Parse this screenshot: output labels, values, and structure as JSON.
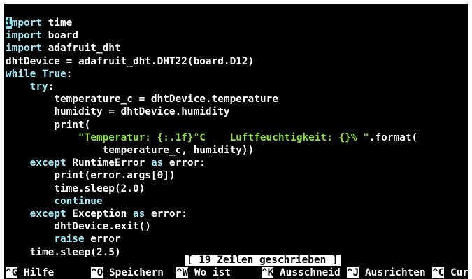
{
  "code_lines": [
    {
      "indent": "",
      "segments": [
        {
          "text": "i",
          "cls": "kw cursor"
        },
        {
          "text": "mport",
          "cls": "kw"
        },
        {
          "text": " time",
          "cls": ""
        }
      ]
    },
    {
      "indent": "",
      "segments": [
        {
          "text": "import",
          "cls": "kw"
        },
        {
          "text": " board",
          "cls": ""
        }
      ]
    },
    {
      "indent": "",
      "segments": [
        {
          "text": "import",
          "cls": "kw"
        },
        {
          "text": " adafruit_dht",
          "cls": ""
        }
      ]
    },
    {
      "indent": "",
      "segments": [
        {
          "text": "dhtDevice = adafruit_dht.DHT22(board.D12)",
          "cls": ""
        }
      ]
    },
    {
      "indent": "",
      "segments": [
        {
          "text": "while",
          "cls": "kw"
        },
        {
          "text": " ",
          "cls": ""
        },
        {
          "text": "True",
          "cls": "kw"
        },
        {
          "text": ":",
          "cls": ""
        }
      ]
    },
    {
      "indent": "    ",
      "segments": [
        {
          "text": "try",
          "cls": "kw"
        },
        {
          "text": ":",
          "cls": ""
        }
      ]
    },
    {
      "indent": "        ",
      "segments": [
        {
          "text": "temperature_c = dhtDevice.temperature",
          "cls": ""
        }
      ]
    },
    {
      "indent": "        ",
      "segments": [
        {
          "text": "humidity = dhtDevice.humidity",
          "cls": ""
        }
      ]
    },
    {
      "indent": "        ",
      "segments": [
        {
          "text": "print(",
          "cls": ""
        }
      ]
    },
    {
      "indent": "            ",
      "segments": [
        {
          "text": "\"Temperatur: {:.1f}°C    Luftfeuchtigkeit: {}% \"",
          "cls": "str"
        },
        {
          "text": ".format(",
          "cls": ""
        }
      ]
    },
    {
      "indent": "                ",
      "segments": [
        {
          "text": "temperature_c, humidity))",
          "cls": ""
        }
      ]
    },
    {
      "indent": "    ",
      "segments": [
        {
          "text": "except",
          "cls": "kw"
        },
        {
          "text": " RuntimeError ",
          "cls": ""
        },
        {
          "text": "as",
          "cls": "kw"
        },
        {
          "text": " error:",
          "cls": ""
        }
      ]
    },
    {
      "indent": "        ",
      "segments": [
        {
          "text": "print(error.args[0])",
          "cls": ""
        }
      ]
    },
    {
      "indent": "        ",
      "segments": [
        {
          "text": "time.sleep(2.0)",
          "cls": ""
        }
      ]
    },
    {
      "indent": "        ",
      "segments": [
        {
          "text": "continue",
          "cls": "kw"
        }
      ]
    },
    {
      "indent": "    ",
      "segments": [
        {
          "text": "except",
          "cls": "kw"
        },
        {
          "text": " Exception ",
          "cls": ""
        },
        {
          "text": "as",
          "cls": "kw"
        },
        {
          "text": " error:",
          "cls": ""
        }
      ]
    },
    {
      "indent": "        ",
      "segments": [
        {
          "text": "dhtDevice.exit()",
          "cls": ""
        }
      ]
    },
    {
      "indent": "        ",
      "segments": [
        {
          "text": "raise",
          "cls": "kw"
        },
        {
          "text": " error",
          "cls": ""
        }
      ]
    },
    {
      "indent": "    ",
      "segments": [
        {
          "text": "time.sleep(2.5)",
          "cls": ""
        }
      ]
    }
  ],
  "status": {
    "message": "[ 19 Zeilen geschrieben ]"
  },
  "shortcuts": [
    {
      "key": "^G",
      "label": " Hilfe"
    },
    {
      "key": "^O",
      "label": " Speichern"
    },
    {
      "key": "^W",
      "label": " Wo ist"
    },
    {
      "key": "^K",
      "label": " Ausschneid"
    },
    {
      "key": "^J",
      "label": " Ausrichten"
    },
    {
      "key": "^C",
      "label": " Cur"
    }
  ],
  "colors": {
    "background": "#000000",
    "keyword": "#9be9f4",
    "string": "#8ee23d",
    "text": "#ffffff"
  }
}
